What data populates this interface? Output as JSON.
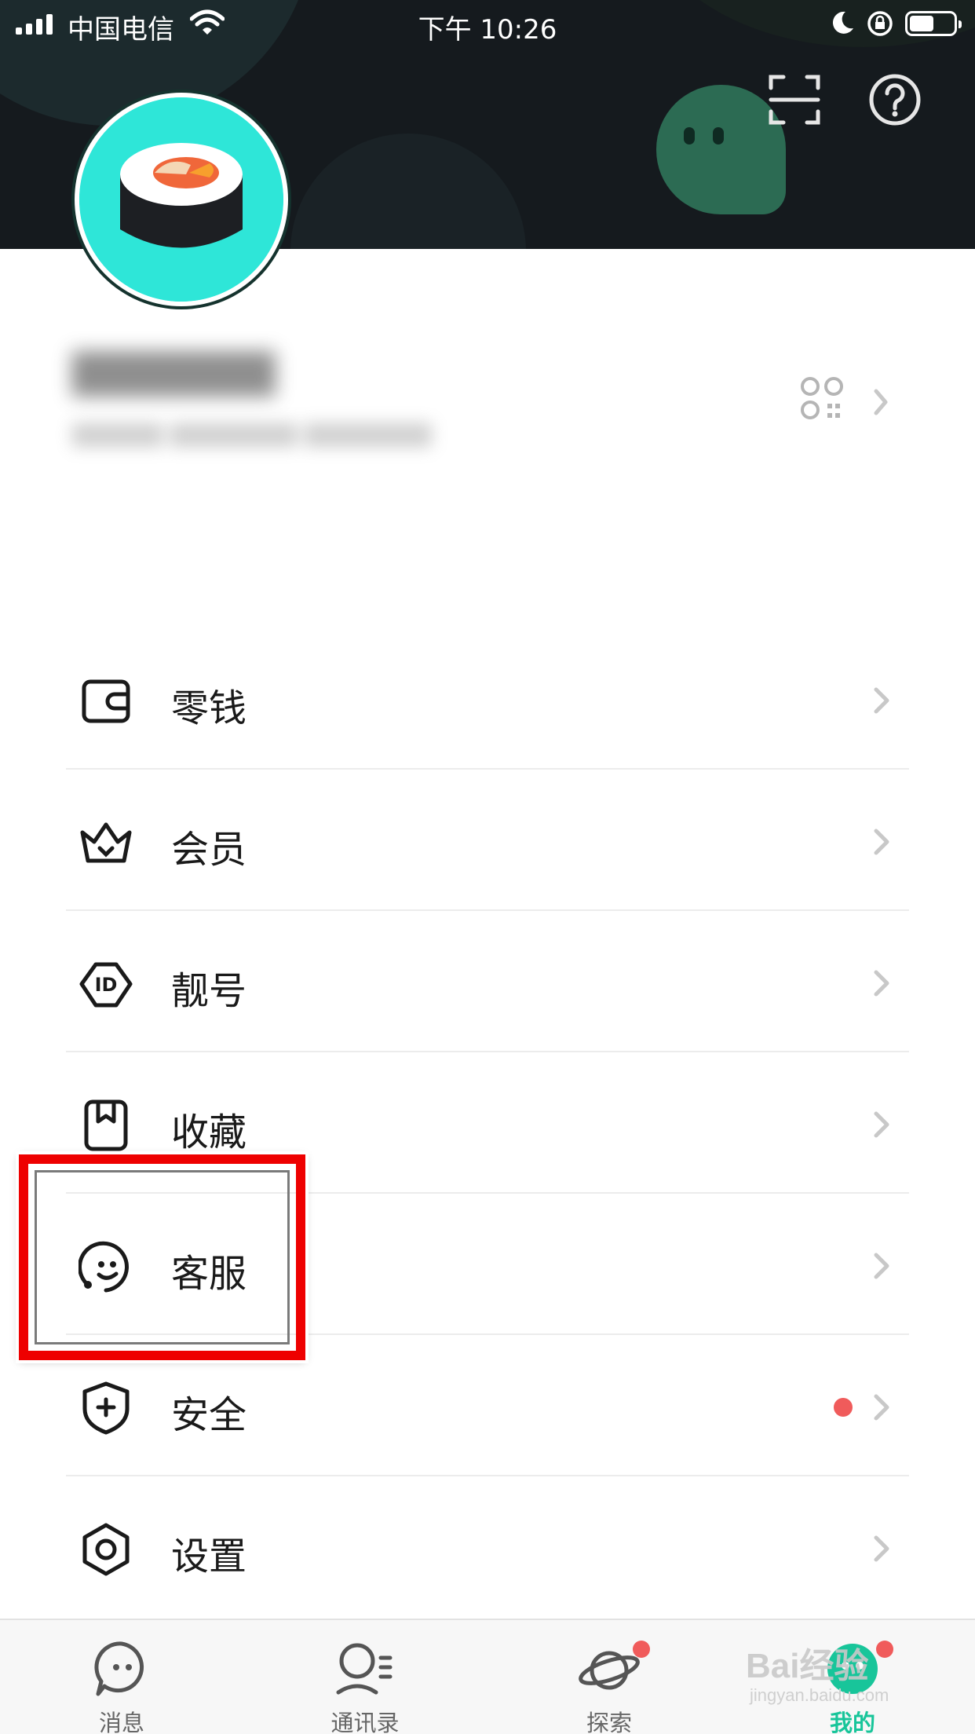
{
  "status_bar": {
    "carrier": "中国电信",
    "time": "下午 10:26"
  },
  "header": {
    "scan_icon": "scan-icon",
    "help_icon": "help-icon"
  },
  "profile": {
    "name": "",
    "account_id": "",
    "qr_icon": "qr-code-icon"
  },
  "menu": {
    "items": [
      {
        "label": "零钱",
        "icon": "wallet-icon",
        "badge": false
      },
      {
        "label": "会员",
        "icon": "crown-icon",
        "badge": false
      },
      {
        "label": "靓号",
        "icon": "id-tag-icon",
        "badge": false
      },
      {
        "label": "收藏",
        "icon": "bookmark-icon",
        "badge": false
      },
      {
        "label": "客服",
        "icon": "customer-service-icon",
        "badge": false
      },
      {
        "label": "安全",
        "icon": "shield-icon",
        "badge": true
      },
      {
        "label": "设置",
        "icon": "settings-icon",
        "badge": false
      }
    ]
  },
  "tabbar": {
    "tabs": [
      {
        "label": "消息",
        "icon": "chat-icon",
        "active": false,
        "badge": false
      },
      {
        "label": "通讯录",
        "icon": "contacts-icon",
        "active": false,
        "badge": false
      },
      {
        "label": "探索",
        "icon": "planet-icon",
        "active": false,
        "badge": true
      },
      {
        "label": "我的",
        "icon": "me-icon",
        "active": true,
        "badge": true
      }
    ]
  },
  "watermark": {
    "text": "Bai经验",
    "url": "jingyan.baidu.com"
  },
  "colors": {
    "accent": "#18c59a",
    "header_bg": "#151a1e",
    "badge": "#f05b5b",
    "highlight": "#ee0000"
  }
}
